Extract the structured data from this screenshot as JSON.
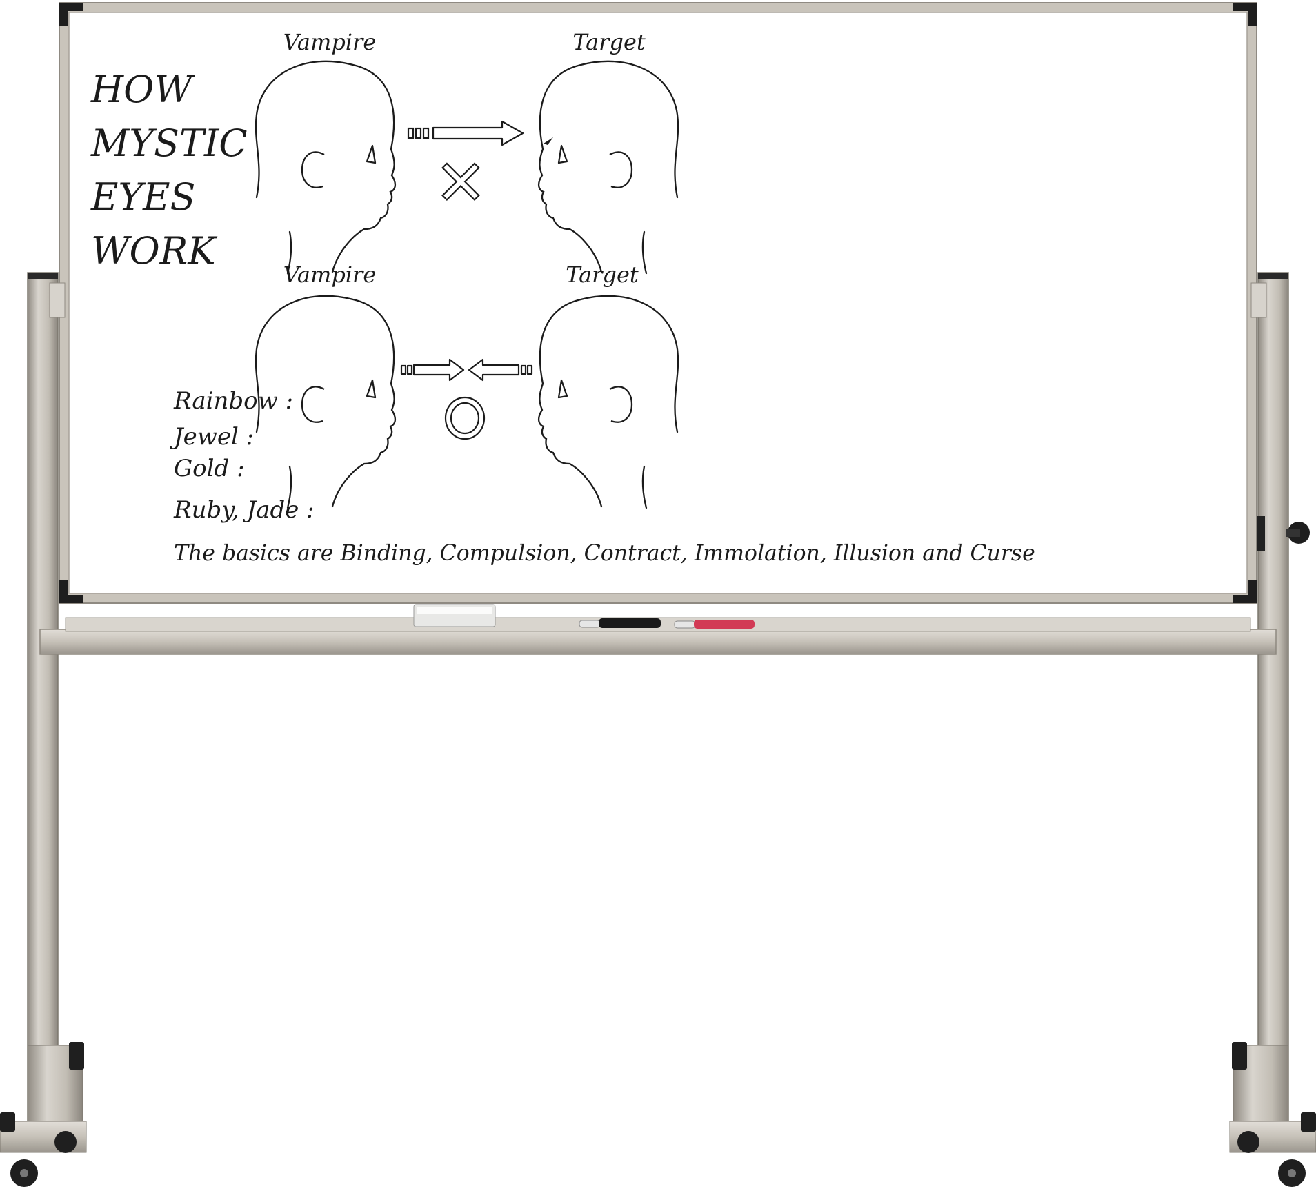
{
  "board": {
    "title_lines": [
      "HOW",
      "MYSTIC",
      "EYES",
      "WORK"
    ],
    "top_panel": {
      "left_label": "Vampire",
      "right_label": "Target",
      "result_symbol": "✕"
    },
    "bottom_panel": {
      "left_label": "Vampire",
      "right_label": "Target",
      "result_symbol": "◯"
    },
    "list_items": [
      "Rainbow :",
      "Jewel  :",
      "Gold :",
      "Ruby, Jade :"
    ],
    "footer_text": "The basics are Binding, Compulsion, Contract, Immolation, Illusion and Curse"
  },
  "tray": {
    "items": [
      "eraser",
      "black-marker",
      "red-marker"
    ]
  },
  "colors": {
    "frame": "#c9c4bb",
    "frame_dark": "#8f8a82",
    "ink": "#1b1b1b",
    "marker_red": "#d23a55",
    "marker_black": "#1a1a1a",
    "caps": "#222222"
  }
}
